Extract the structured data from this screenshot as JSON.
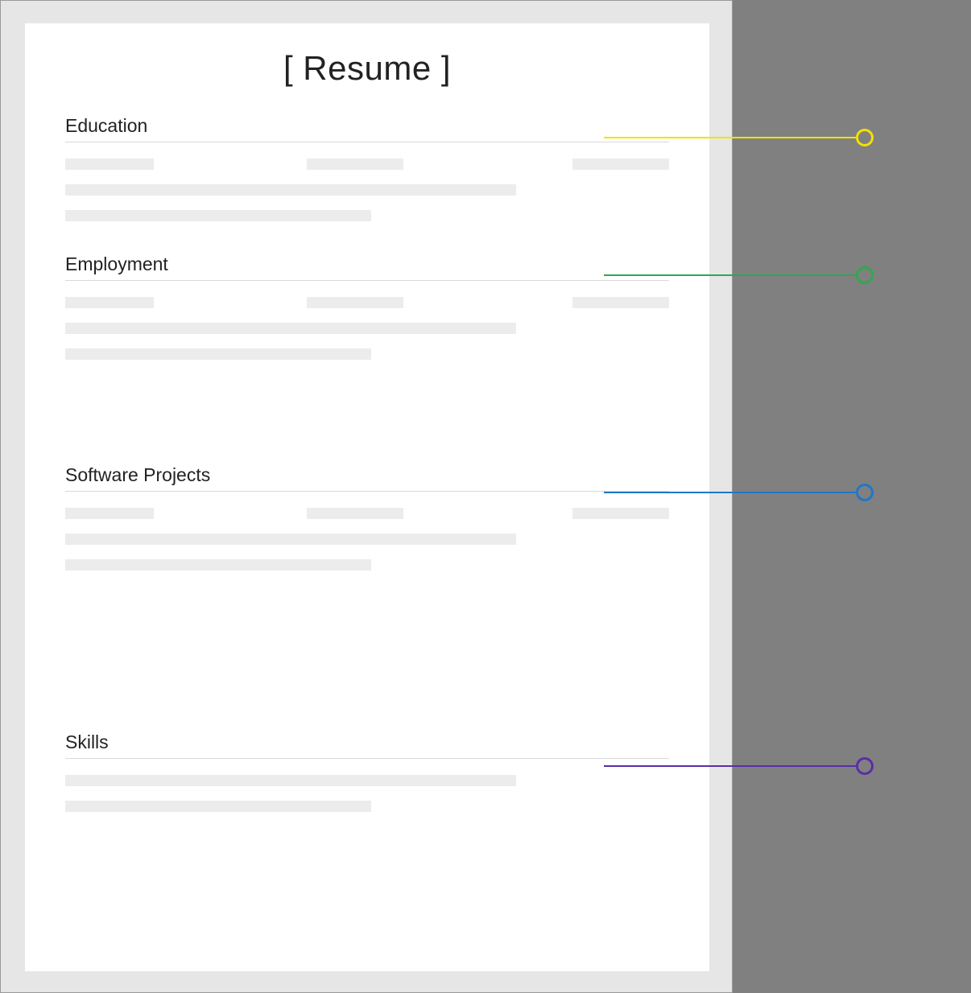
{
  "document": {
    "title": "[ Resume ]",
    "sections": [
      {
        "heading": "Education"
      },
      {
        "heading": "Employment"
      },
      {
        "heading": "Software Projects"
      },
      {
        "heading": "Skills"
      }
    ]
  },
  "callouts": [
    {
      "color": "#f2e100",
      "name": "education"
    },
    {
      "color": "#2fa84f",
      "name": "employment"
    },
    {
      "color": "#1f77c9",
      "name": "software-projects"
    },
    {
      "color": "#5a2ea6",
      "name": "skills"
    }
  ]
}
